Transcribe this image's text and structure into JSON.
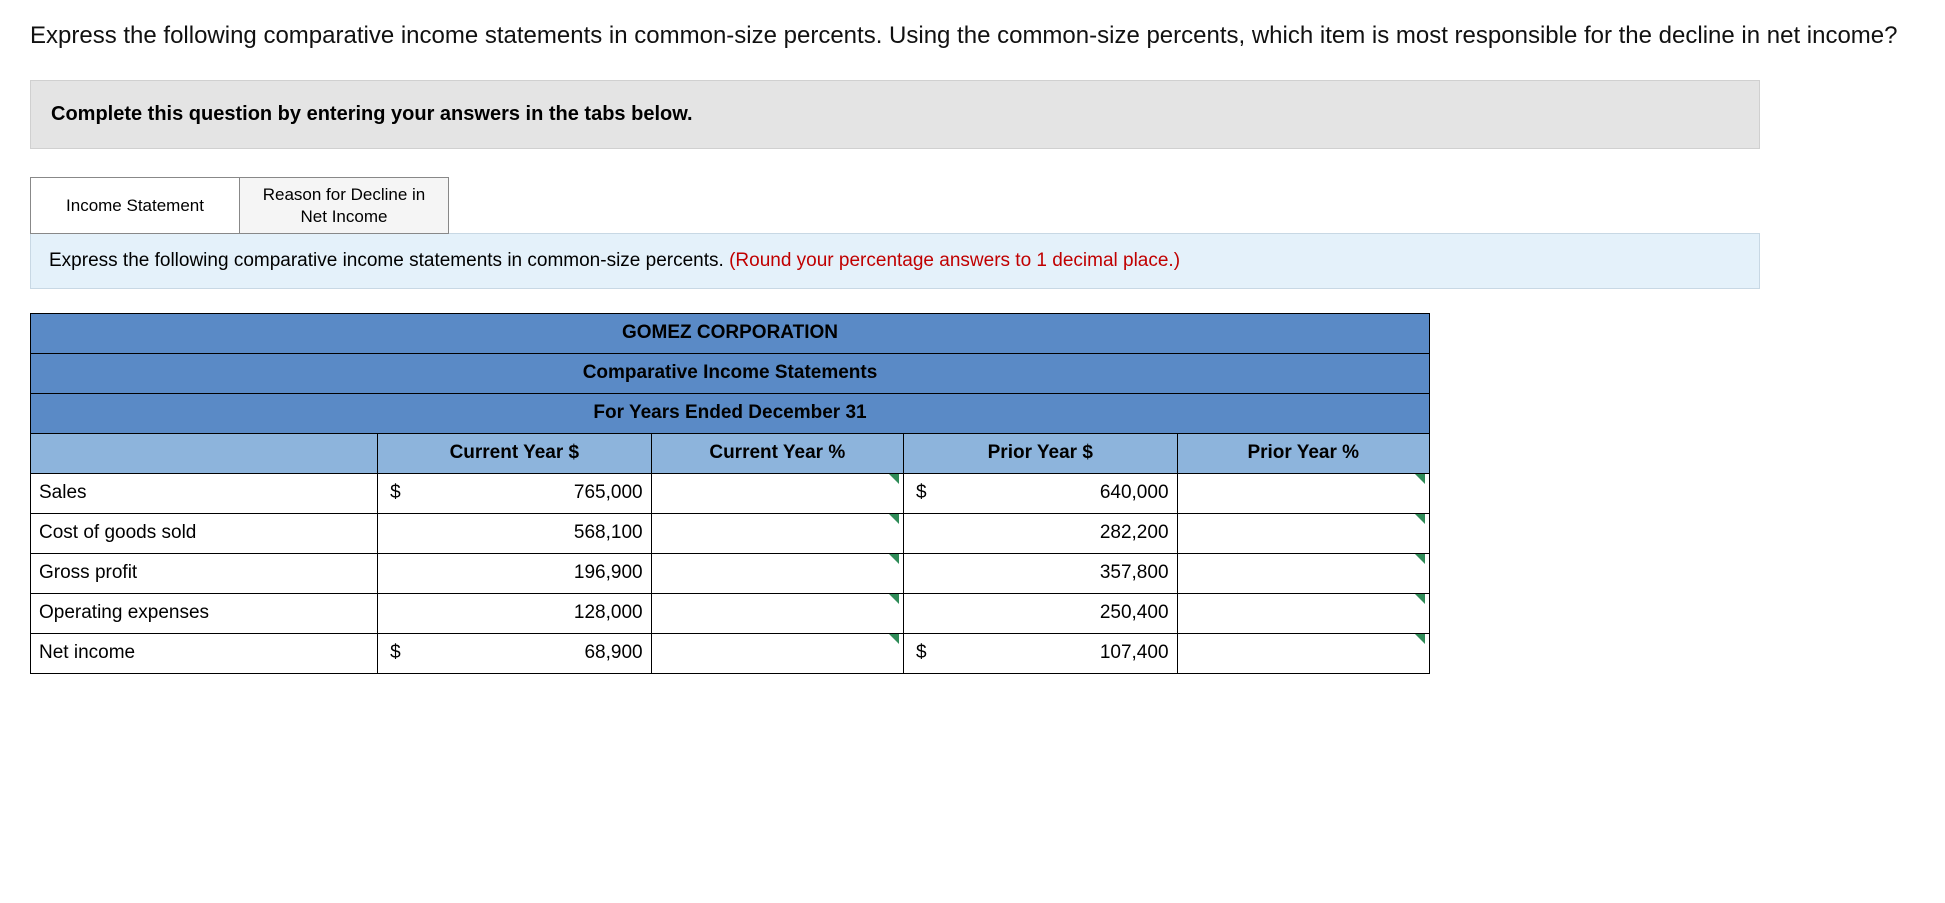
{
  "question": "Express the following comparative income statements in common-size percents. Using the common-size percents, which item is most responsible for the decline in net income?",
  "instruction_banner": "Complete this question by entering your answers in the tabs below.",
  "tabs": {
    "income_statement": "Income Statement",
    "reason": "Reason for Decline in Net Income"
  },
  "panel": {
    "text": "Express the following comparative income statements in common-size percents. ",
    "note": "(Round your percentage answers to 1 decimal place.)"
  },
  "table": {
    "title1": "GOMEZ CORPORATION",
    "title2": "Comparative Income Statements",
    "title3": "For Years Ended December 31",
    "headers": {
      "cy_dollar": "Current Year $",
      "cy_pct": "Current Year %",
      "py_dollar": "Prior Year $",
      "py_pct": "Prior Year %"
    },
    "rows": [
      {
        "label": "Sales",
        "cy_sym": "$",
        "cy_val": "765,000",
        "py_sym": "$",
        "py_val": "640,000"
      },
      {
        "label": "Cost of goods sold",
        "cy_sym": "",
        "cy_val": "568,100",
        "py_sym": "",
        "py_val": "282,200"
      },
      {
        "label": "Gross profit",
        "cy_sym": "",
        "cy_val": "196,900",
        "py_sym": "",
        "py_val": "357,800"
      },
      {
        "label": "Operating expenses",
        "cy_sym": "",
        "cy_val": "128,000",
        "py_sym": "",
        "py_val": "250,400"
      },
      {
        "label": "Net income",
        "cy_sym": "$",
        "cy_val": "68,900",
        "py_sym": "$",
        "py_val": "107,400"
      }
    ]
  }
}
